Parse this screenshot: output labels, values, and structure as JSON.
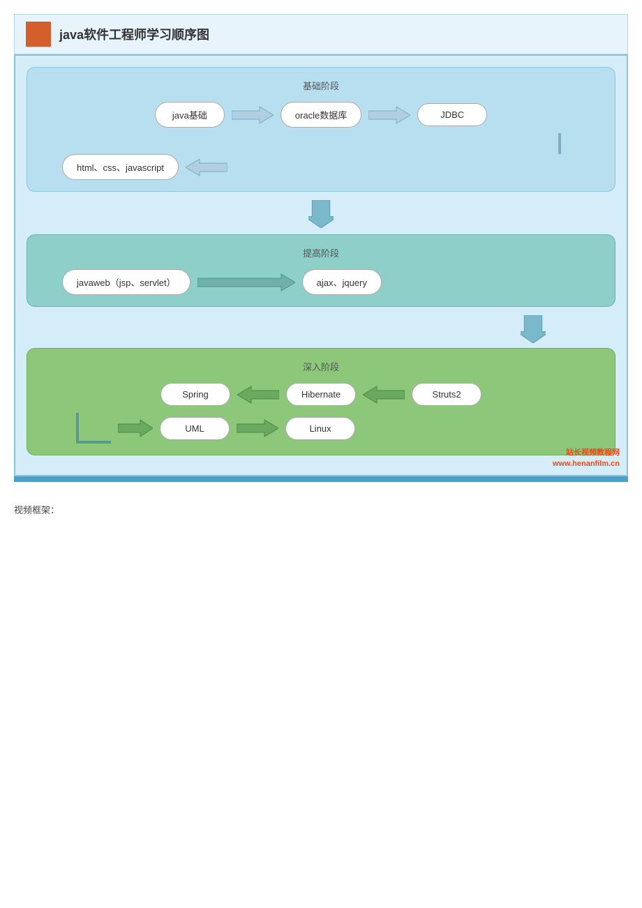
{
  "title": "java软件工程师学习顺序图",
  "stages": {
    "basic": {
      "label": "基础阶段",
      "nodes": [
        "java基础",
        "oracle数据库",
        "JDBC",
        "html、css、javascript"
      ]
    },
    "improve": {
      "label": "提高阶段",
      "nodes": [
        "javaweb（jsp、servlet）",
        "ajax、jquery"
      ]
    },
    "deep": {
      "label": "深入阶段",
      "nodes": [
        "Spring",
        "Hibernate",
        "Struts2",
        "UML",
        "Linux"
      ]
    }
  },
  "watermark": {
    "line1": "站长视频教程网",
    "line2": "www.henanfilm.cn"
  },
  "videoFrameLabel": "视频框架："
}
